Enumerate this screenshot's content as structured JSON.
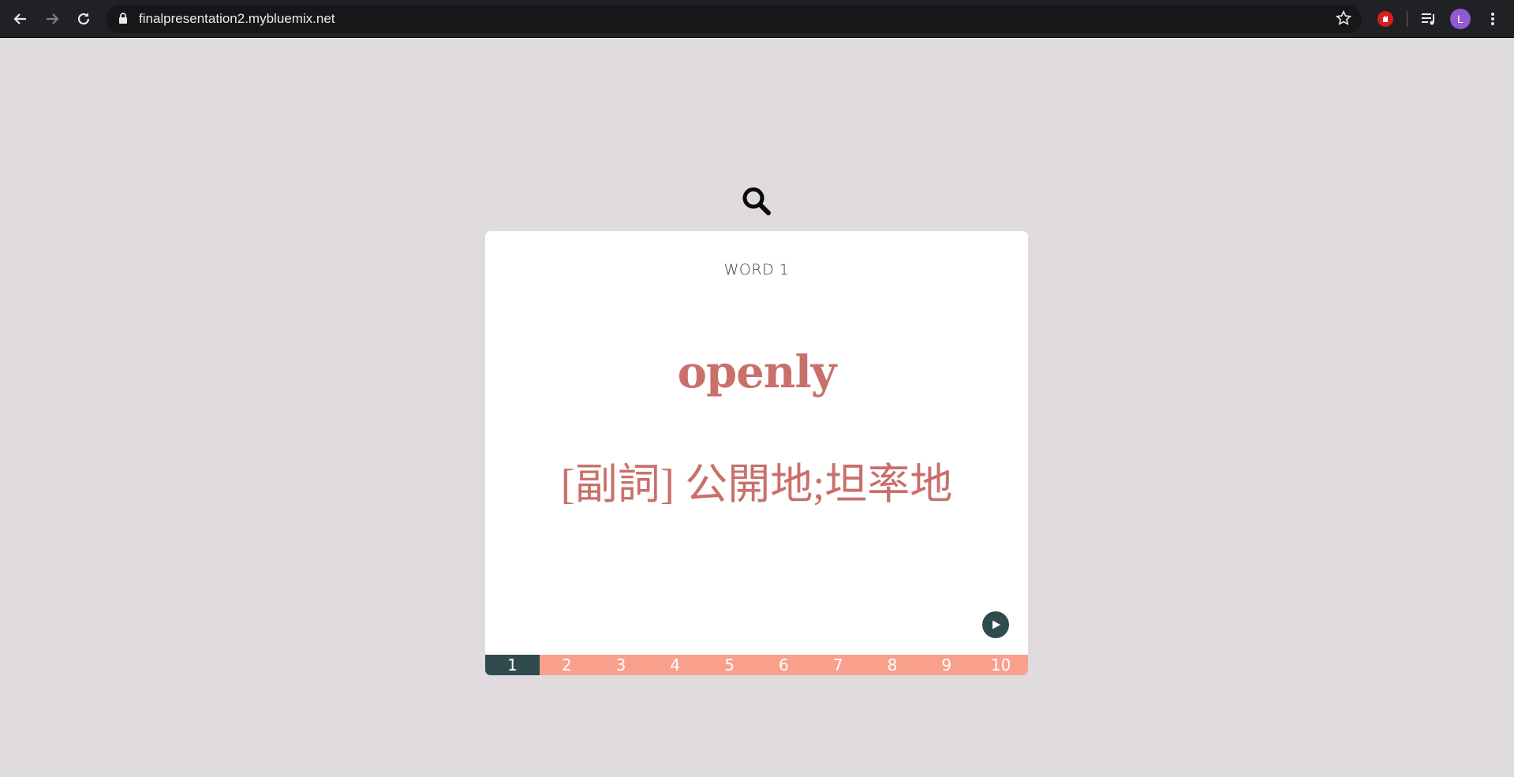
{
  "browser": {
    "url": "finalpresentation2.mybluemix.net",
    "profile_initial": "L",
    "icons": [
      "back-arrow-icon",
      "forward-arrow-icon",
      "reload-icon",
      "lock-icon",
      "star-icon",
      "extension-stop-icon",
      "media-queue-icon",
      "more-vert-icon"
    ]
  },
  "page": {
    "search_icon": "search-icon",
    "word_label": "WORD 1",
    "word": "openly",
    "definition": "[副詞] 公開地;坦率地",
    "play_icon": "play-icon",
    "pages": [
      "1",
      "2",
      "3",
      "4",
      "5",
      "6",
      "7",
      "8",
      "9",
      "10"
    ],
    "active_page": "1",
    "colors": {
      "background": "#dfdbdf",
      "accent": "#c9706b",
      "dark_teal": "#2f4b4e",
      "pager": "#f9a08d"
    }
  }
}
